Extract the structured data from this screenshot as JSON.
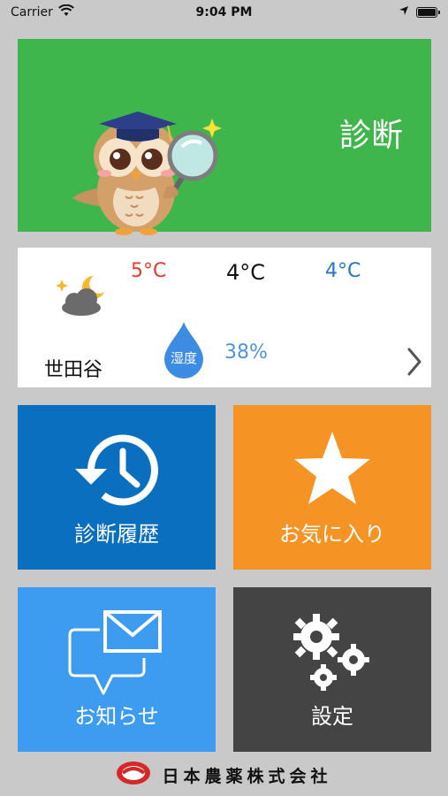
{
  "status_bar": {
    "carrier": "Carrier",
    "time": "9:04 PM"
  },
  "diagnosis": {
    "title": "診断"
  },
  "weather": {
    "temp_max": "5°C",
    "temp_now": "4°C",
    "temp_min": "4°C",
    "city": "世田谷",
    "humidity_label": "湿度",
    "humidity": "38%"
  },
  "menu": {
    "history_label": "診断履歴",
    "favorites_label": "お気に入り",
    "notices_label": "お知らせ",
    "settings_label": "設定"
  },
  "footer": {
    "company": "日本農薬株式会社"
  },
  "colors": {
    "diagnosis_bg": "#3fb64c",
    "history_bg": "#0b6fc0",
    "favorites_bg": "#f59324",
    "notices_bg": "#3d9bf0",
    "settings_bg": "#444444",
    "temp_max": "#e23b2b",
    "temp_min": "#1e78c8",
    "humidity": "#4f93e0"
  },
  "icons": [
    "wifi-icon",
    "location-arrow-icon",
    "battery-icon",
    "owl-mascot-icon",
    "weather-partly-cloudy-night-icon",
    "humidity-drop-icon",
    "chevron-right-icon",
    "history-clock-icon",
    "star-icon",
    "mail-chat-icon",
    "gears-icon",
    "company-logo-icon"
  ]
}
